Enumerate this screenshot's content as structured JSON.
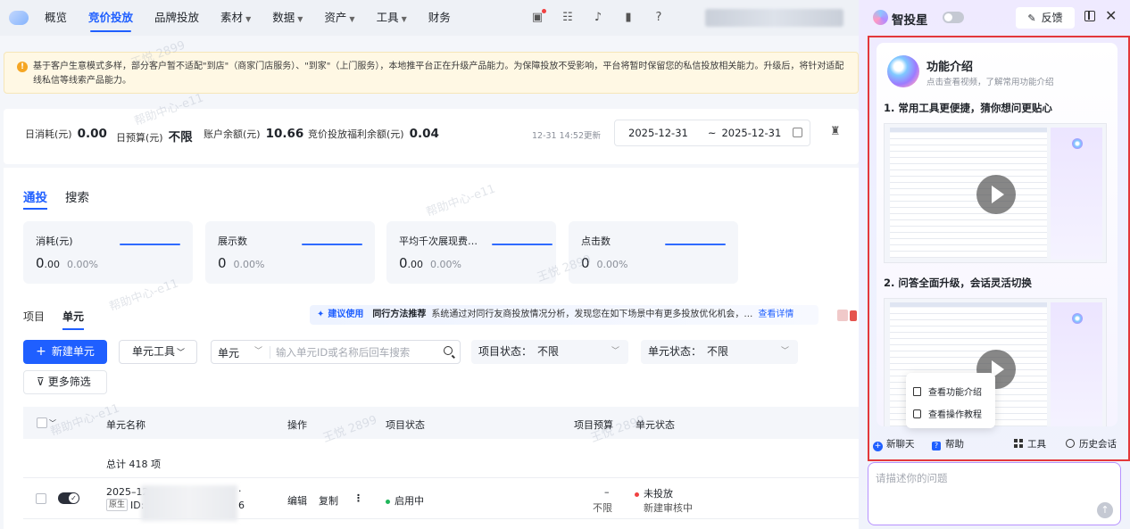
{
  "nav": {
    "items": [
      {
        "label": "概览",
        "active": false,
        "caret": false
      },
      {
        "label": "竞价投放",
        "active": true,
        "caret": false
      },
      {
        "label": "品牌投放",
        "active": false,
        "caret": false
      },
      {
        "label": "素材",
        "active": false,
        "caret": true
      },
      {
        "label": "数据",
        "active": false,
        "caret": true
      },
      {
        "label": "资产",
        "active": false,
        "caret": true
      },
      {
        "label": "工具",
        "active": false,
        "caret": true
      },
      {
        "label": "财务",
        "active": false,
        "caret": false
      }
    ],
    "icons": [
      "gift-icon",
      "grid-icon",
      "bell-icon",
      "document-icon",
      "help-icon"
    ]
  },
  "notice": {
    "text": "基于客户生意模式多样，部分客户暂不适配\"到店\"（商家门店服务）、\"到家\"（上门服务），本地推平台正在升级产品能力。为保障投放不受影响，平台将暂时保留您的私信投放相关能力。升级后，将针对适配线私信等线索产品能力。"
  },
  "stats": {
    "daily_spend_label": "日消耗(元)",
    "daily_spend": "0.00",
    "daily_budget_label": "日预算(元)",
    "daily_budget": "不限",
    "balance_label": "账户余额(元)",
    "balance": "10.66",
    "welfare_label": "竞价投放福利余额(元)",
    "welfare": "0.04",
    "updated": "12-31 14:52更新",
    "date_start": "2025-12-31",
    "date_sep": "~",
    "date_end": "2025-12-31"
  },
  "main": {
    "tabs": [
      {
        "label": "通投",
        "active": true
      },
      {
        "label": "搜索",
        "active": false
      }
    ],
    "metrics": [
      {
        "name": "消耗(元)",
        "int": "0",
        "dec": ".00",
        "pct": "0.00%"
      },
      {
        "name": "展示数",
        "int": "0",
        "dec": "",
        "pct": "0.00%"
      },
      {
        "name": "平均千次展现费用(元)",
        "int": "0",
        "dec": ".00",
        "pct": "0.00%"
      },
      {
        "name": "点击数",
        "int": "0",
        "dec": "",
        "pct": "0.00%"
      }
    ],
    "subtabs": [
      {
        "label": "项目",
        "active": false
      },
      {
        "label": "单元",
        "active": true
      }
    ],
    "recommend": {
      "tag": "建议使用",
      "title": "同行方法推荐",
      "text": "系统通过对同行友商投放情况分析，发现您在如下场景中有更多投放优化机会，…",
      "link": "查看详情"
    },
    "new_unit_label": "新建单元",
    "unit_tools_label": "单元工具",
    "search": {
      "select": "单元",
      "placeholder": "输入单元ID或名称后回车搜索",
      "value": ""
    },
    "project_status": {
      "label": "项目状态：",
      "value": "不限"
    },
    "unit_status": {
      "label": "单元状态：",
      "value": "不限"
    },
    "more_filter_label": "更多筛选",
    "table": {
      "headers": [
        "单元名称",
        "操作",
        "项目状态",
        "项目预算",
        "单元状态"
      ],
      "total": "总计 418 项",
      "rows": [
        {
          "name": "2025–12",
          "tag": "原生",
          "id_label": "ID:",
          "id_tail": "6",
          "actions": [
            "编辑",
            "复制"
          ],
          "project_status": "启用中",
          "budget_top": "–",
          "budget": "不限",
          "unit_status": "未投放",
          "unit_sub": "新建审核中"
        }
      ]
    }
  },
  "assistant": {
    "title": "智投星",
    "feedback_label": "反馈",
    "card_title": "功能介绍",
    "card_sub": "点击查看视频，了解常用功能介绍",
    "sections": [
      {
        "heading": "1. 常用工具更便捷，猜你想问更贴心"
      },
      {
        "heading": "2. 问答全面升级，会话灵活切换"
      }
    ],
    "popup": [
      "查看功能介绍",
      "查看操作教程"
    ],
    "actions": [
      "新聊天",
      "帮助",
      "工具",
      "历史会话"
    ],
    "input_placeholder": "请描述你的问题"
  },
  "watermark": [
    "帮助中心-e11",
    "王悦 2899"
  ],
  "colors": {
    "accent": "#1f5fff",
    "highlight": "#e3383a",
    "input_border": "#b792ff"
  }
}
